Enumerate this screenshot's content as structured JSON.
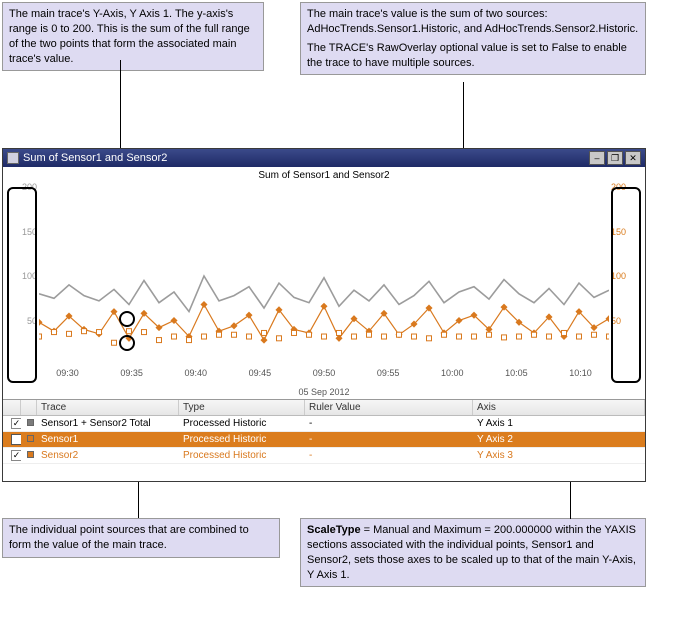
{
  "notes": {
    "top_left": "The main trace's Y-Axis, Y Axis 1. The y-axis's range is 0 to 200. This is the sum of the full range of the two points that form the associated main trace's value.",
    "top_right_p1": "The main trace's value is the sum of two sources: AdHocTrends.Sensor1.Historic, and AdHocTrends.Sensor2.Historic.",
    "top_right_p2": "The TRACE's RawOverlay optional value is set to False to enable the trace to have multiple sources.",
    "bottom_left": "The individual point sources that are combined to form the value of the main trace.",
    "bottom_right": "ScaleType = Manual and Maximum = 200.000000 within the YAXIS sections associated with the individual points, Sensor1 and Sensor2, sets those axes to be scaled up to that of the main Y-Axis, Y Axis 1."
  },
  "window": {
    "title": "Sum of Sensor1 and Sensor2",
    "min_label": "–",
    "restore_label": "❐",
    "close_label": "✕"
  },
  "chart_data": {
    "type": "line",
    "title": "Sum of Sensor1 and Sensor2",
    "x_date": "05 Sep 2012",
    "ylabel": "",
    "xlabel": "",
    "ylim": [
      0,
      200
    ],
    "y_ticks_left": [
      50,
      100,
      150,
      200
    ],
    "y_ticks_right": [
      50,
      100,
      150,
      200
    ],
    "x_ticks": [
      "09:30",
      "09:35",
      "09:40",
      "09:45",
      "09:50",
      "09:55",
      "10:00",
      "10:05",
      "10:10"
    ],
    "series": [
      {
        "name": "Sensor1 + Sensor2 Total",
        "color": "#9c9c9c",
        "style": "line",
        "values": [
          80,
          75,
          90,
          78,
          72,
          85,
          68,
          95,
          70,
          82,
          60,
          100,
          72,
          78,
          88,
          64,
          92,
          76,
          70,
          98,
          66,
          84,
          72,
          90,
          68,
          78,
          94,
          70,
          82,
          88,
          74,
          96,
          80,
          70,
          86,
          68,
          92,
          76,
          84
        ]
      },
      {
        "name": "Sensor1",
        "color": "#d9791e",
        "style": "line-dot-diamond",
        "values": [
          48,
          38,
          55,
          40,
          35,
          60,
          30,
          58,
          42,
          50,
          32,
          68,
          38,
          44,
          56,
          28,
          62,
          40,
          36,
          66,
          30,
          52,
          38,
          58,
          34,
          46,
          64,
          36,
          50,
          56,
          40,
          65,
          48,
          36,
          54,
          32,
          60,
          42,
          52
        ]
      },
      {
        "name": "Sensor2",
        "color": "#d9791e",
        "style": "dot-square",
        "values": [
          32,
          37,
          35,
          38,
          37,
          25,
          38,
          37,
          28,
          32,
          28,
          32,
          34,
          34,
          32,
          36,
          30,
          36,
          34,
          32,
          36,
          32,
          34,
          32,
          34,
          32,
          30,
          34,
          32,
          32,
          34,
          31,
          32,
          34,
          32,
          36,
          32,
          34,
          32
        ]
      }
    ]
  },
  "grid": {
    "headers": {
      "trace": "Trace",
      "type": "Type",
      "ruler": "Ruler Value",
      "axis": "Axis"
    },
    "rows": [
      {
        "checked": true,
        "key_color": "#7b7b7b",
        "name": "Sensor1 + Sensor2 Total",
        "type": "Processed Historic",
        "ruler": "-",
        "axis": "Y Axis 1",
        "selected": false
      },
      {
        "checked": true,
        "key_color": "#d9791e",
        "name": "Sensor1",
        "type": "Processed Historic",
        "ruler": "-",
        "axis": "Y Axis 2",
        "selected": true
      },
      {
        "checked": true,
        "key_color": "#d9791e",
        "name": "Sensor2",
        "type": "Processed Historic",
        "ruler": "-",
        "axis": "Y Axis 3",
        "selected": false
      }
    ]
  },
  "scaletype_emph": "ScaleType"
}
